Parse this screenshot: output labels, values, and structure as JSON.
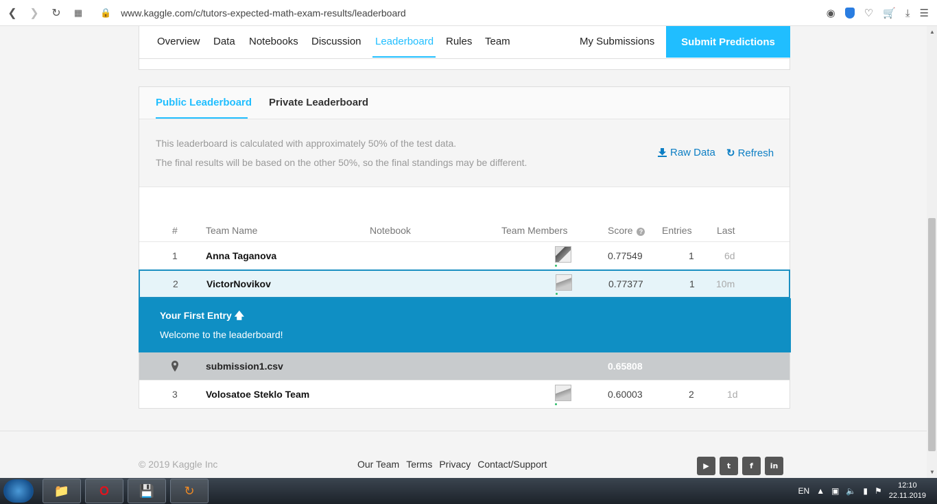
{
  "browser": {
    "url": "www.kaggle.com/c/tutors-expected-math-exam-results/leaderboard"
  },
  "topnav": {
    "tabs": [
      "Overview",
      "Data",
      "Notebooks",
      "Discussion",
      "Leaderboard",
      "Rules",
      "Team"
    ],
    "active_tab": "Leaderboard",
    "my_submissions": "My Submissions",
    "submit_predictions": "Submit Predictions"
  },
  "leaderboard": {
    "tabs": [
      "Public Leaderboard",
      "Private Leaderboard"
    ],
    "active_tab": "Public Leaderboard",
    "info_line1": "This leaderboard is calculated with approximately 50% of the test data.",
    "info_line2": "The final results will be based on the other 50%, so the final standings may be different.",
    "raw_data": "Raw Data",
    "refresh": "Refresh",
    "columns": {
      "rank": "#",
      "team_name": "Team Name",
      "notebook": "Notebook",
      "team_members": "Team Members",
      "score": "Score",
      "entries": "Entries",
      "last": "Last"
    },
    "rows": [
      {
        "rank": "1",
        "name": "Anna Taganova",
        "score": "0.77549",
        "entries": "1",
        "last": "6d"
      },
      {
        "rank": "2",
        "name": "VictorNovikov",
        "score": "0.77377",
        "entries": "1",
        "last": "10m"
      },
      {
        "rank": "3",
        "name": "Volosatoe Steklo Team",
        "score": "0.60003",
        "entries": "2",
        "last": "1d"
      }
    ],
    "banner": {
      "title": "Your First Entry",
      "subtitle": "Welcome to the leaderboard!"
    },
    "submission": {
      "name": "submission1.csv",
      "score": "0.65808"
    }
  },
  "footer": {
    "copyright": "© 2019 Kaggle Inc",
    "links": [
      "Our Team",
      "Terms",
      "Privacy",
      "Contact/Support"
    ],
    "social": [
      "youtube-icon",
      "twitter-icon",
      "facebook-icon",
      "linkedin-icon"
    ]
  },
  "taskbar": {
    "lang": "EN",
    "time": "12:10",
    "date": "22.11.2019"
  },
  "colors": {
    "accent": "#20beff",
    "banner": "#0f8fc4",
    "link": "#0c7ec4"
  }
}
